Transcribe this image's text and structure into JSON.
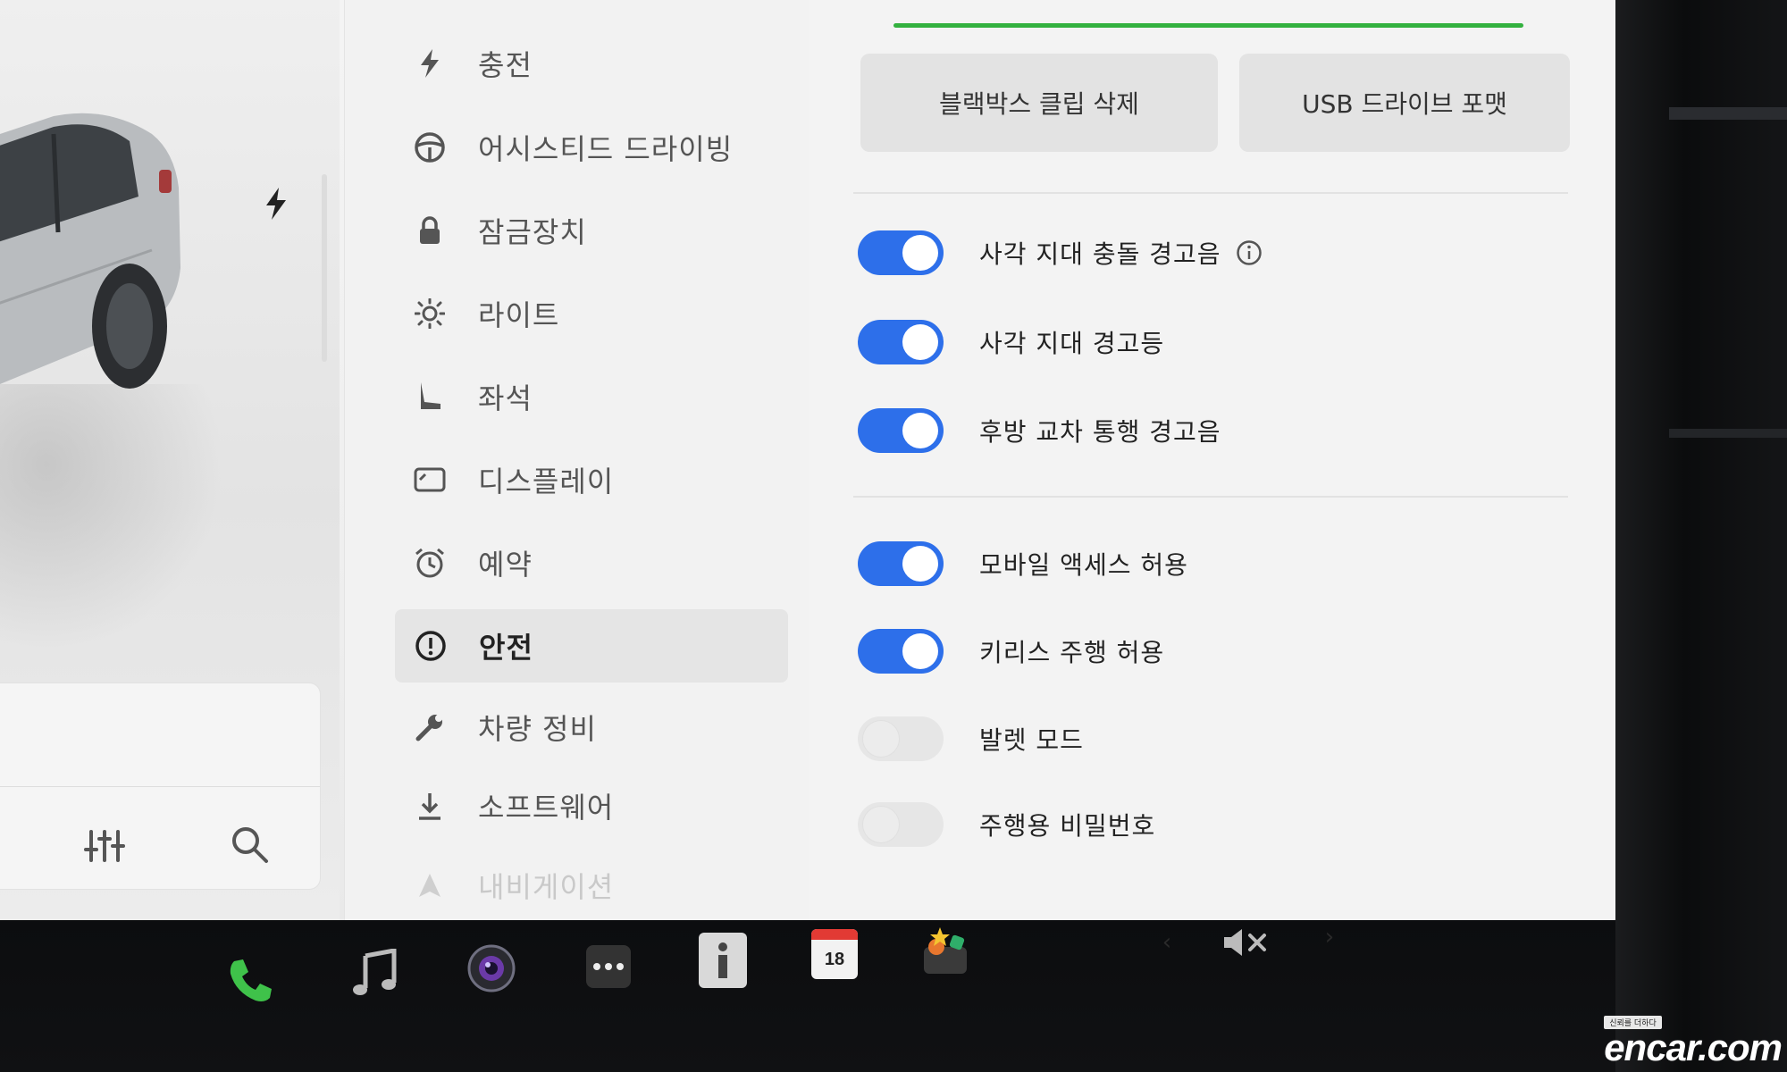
{
  "menu": {
    "items": [
      {
        "label": "충전",
        "icon": "bolt-icon"
      },
      {
        "label": "어시스티드 드라이빙",
        "icon": "steering-wheel-icon"
      },
      {
        "label": "잠금장치",
        "icon": "lock-icon"
      },
      {
        "label": "라이트",
        "icon": "light-icon"
      },
      {
        "label": "좌석",
        "icon": "seat-icon"
      },
      {
        "label": "디스플레이",
        "icon": "display-icon"
      },
      {
        "label": "예약",
        "icon": "alarm-clock-icon"
      },
      {
        "label": "안전",
        "icon": "alert-circle-icon",
        "active": true
      },
      {
        "label": "차량 정비",
        "icon": "wrench-icon"
      },
      {
        "label": "소프트웨어",
        "icon": "download-icon"
      },
      {
        "label": "내비게이션",
        "icon": "navigation-icon"
      }
    ]
  },
  "content": {
    "buttons": {
      "dashcam_delete": "블랙박스 클립 삭제",
      "usb_format": "USB 드라이브 포맷"
    },
    "toggles": [
      {
        "label": "사각 지대 충돌 경고음",
        "on": true,
        "info": true
      },
      {
        "label": "사각 지대 경고등",
        "on": true
      },
      {
        "label": "후방 교차 통행 경고음",
        "on": true
      },
      {
        "label": "모바일 액세스 허용",
        "on": true
      },
      {
        "label": "키리스 주행 허용",
        "on": true
      },
      {
        "label": "발렛 모드",
        "on": false
      },
      {
        "label": "주행용 비밀번호",
        "on": false
      }
    ]
  },
  "dock": {
    "calendar_day": "18",
    "icons": [
      "phone-icon",
      "music-icon",
      "camera-icon",
      "more-icon",
      "manual-icon",
      "calendar-icon",
      "toybox-icon",
      "volume-muted-icon"
    ],
    "volume_prev": "‹",
    "volume_next": "›"
  },
  "watermark": {
    "tagline": "신뢰를 더하다",
    "logo": "encar.com"
  },
  "colors": {
    "toggle_on": "#2d6fea",
    "progress": "#33b13f",
    "phone": "#3fc24a"
  }
}
